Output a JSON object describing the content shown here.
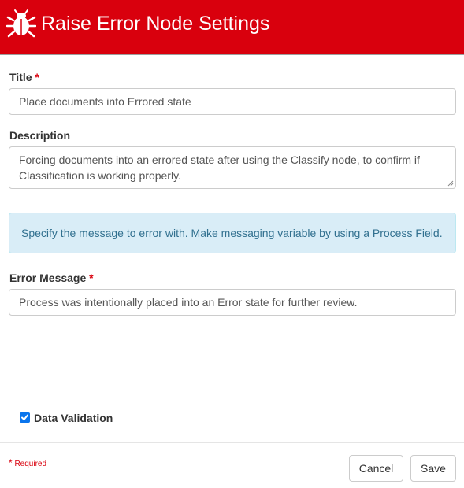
{
  "header": {
    "title": "Raise Error Node Settings",
    "icon": "bug-icon",
    "background_color": "#d9000d"
  },
  "form": {
    "title_label": "Title",
    "title_required_marker": "*",
    "title_value": "Place documents into Errored state",
    "description_label": "Description",
    "description_value": "Forcing documents into an errored state after using the Classify node, to confirm if Classification is working properly.",
    "info_message": "Specify the message to error with. Make messaging variable by using a Process Field.",
    "error_message_label": "Error Message",
    "error_message_required_marker": "*",
    "error_message_value": "Process was intentionally placed into an Error state for further review.",
    "data_validation_label": "Data Validation",
    "data_validation_checked": true
  },
  "footer": {
    "required_marker": "*",
    "required_text": "Required",
    "cancel_label": "Cancel",
    "save_label": "Save"
  }
}
